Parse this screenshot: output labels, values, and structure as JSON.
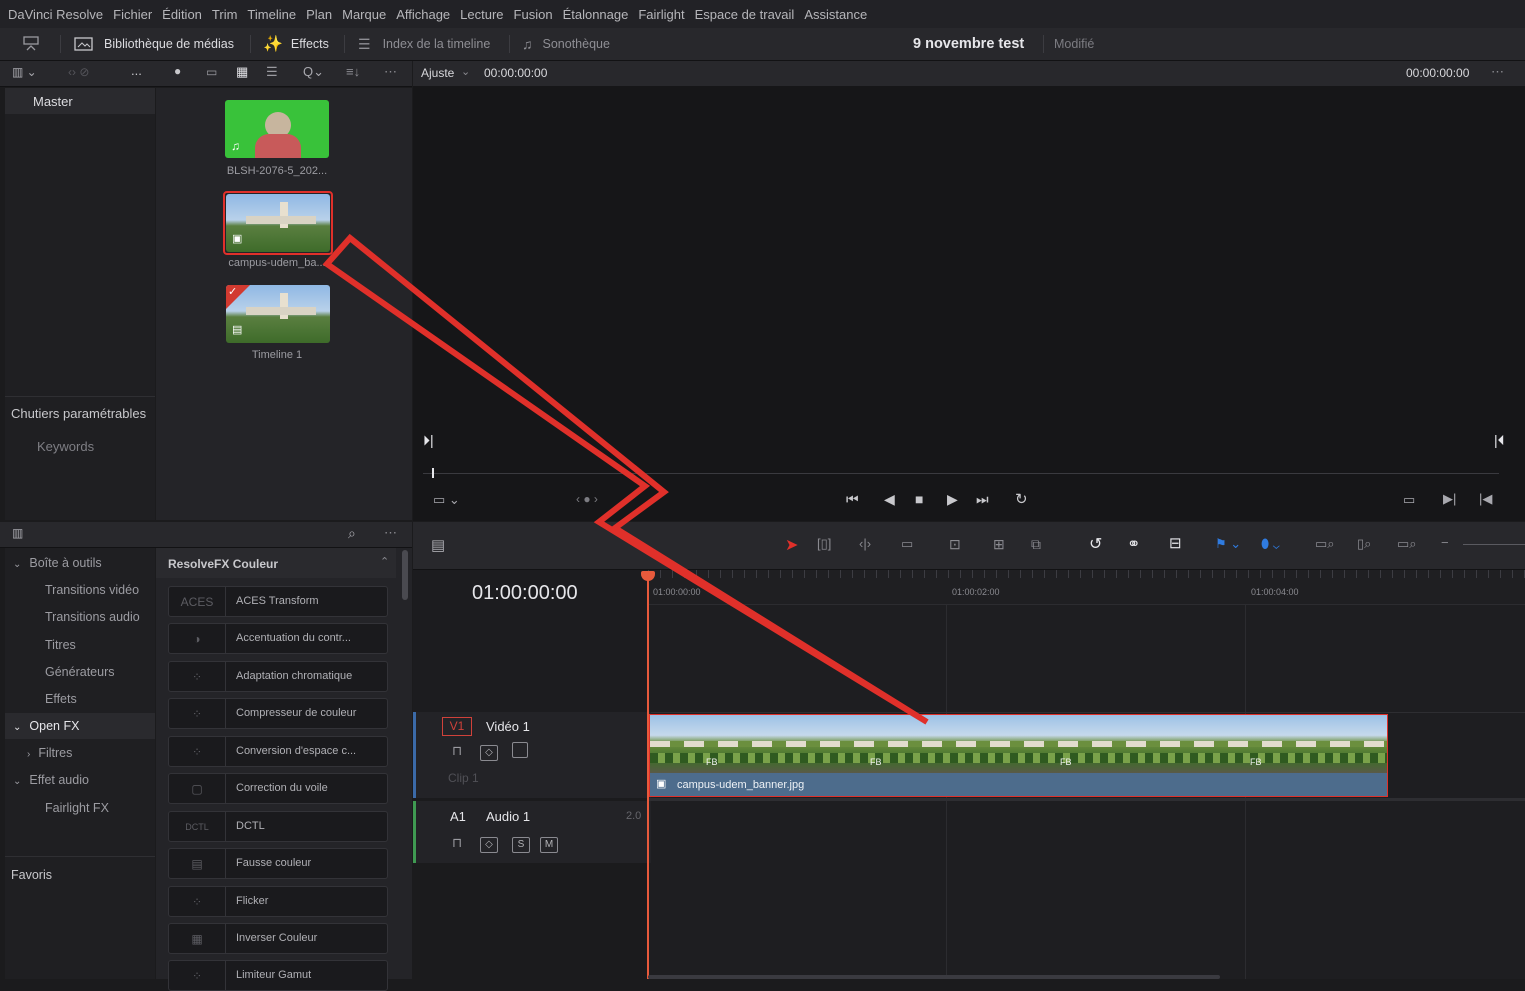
{
  "menu": [
    "DaVinci Resolve",
    "Fichier",
    "Édition",
    "Trim",
    "Timeline",
    "Plan",
    "Marque",
    "Affichage",
    "Lecture",
    "Fusion",
    "Étalonnage",
    "Fairlight",
    "Espace de travail",
    "Assistance"
  ],
  "toolbar": {
    "media_pool": "Bibliothèque de médias",
    "effects": "Effects",
    "timeline_index": "Index de la timeline",
    "sound_library": "Sonothèque",
    "project_title": "9 novembre test",
    "project_status": "Modifié"
  },
  "media_pool": {
    "ellipsis": "...",
    "bins": {
      "master": "Master",
      "smart_bins": "Chutiers paramétrables",
      "keywords": "Keywords"
    },
    "clips": [
      {
        "name": "BLSH-2076-5_202..."
      },
      {
        "name": "campus-udem_ba..."
      },
      {
        "name": "Timeline 1"
      }
    ]
  },
  "viewer": {
    "zoom": "Ajuste",
    "timecode_left": "00:00:00:00",
    "timecode_right": "00:00:00:00"
  },
  "effects": {
    "nav": [
      {
        "label": "Boîte à outils",
        "level": 0,
        "arrow": "v"
      },
      {
        "label": "Transitions vidéo",
        "level": 1
      },
      {
        "label": "Transitions audio",
        "level": 1
      },
      {
        "label": "Titres",
        "level": 1
      },
      {
        "label": "Générateurs",
        "level": 1
      },
      {
        "label": "Effets",
        "level": 1
      },
      {
        "label": "Open FX",
        "level": 0,
        "arrow": "v"
      },
      {
        "label": "Filtres",
        "level": 1,
        "arrow": ">"
      },
      {
        "label": "Effet audio",
        "level": 0,
        "arrow": "v"
      },
      {
        "label": "Fairlight FX",
        "level": 1
      }
    ],
    "favorites": "Favoris",
    "category": "ResolveFX Couleur",
    "items": [
      {
        "name": "ACES Transform",
        "icon": "ACES"
      },
      {
        "name": "Accentuation du contr...",
        "icon": "◑"
      },
      {
        "name": "Adaptation chromatique",
        "icon": "⁘"
      },
      {
        "name": "Compresseur de couleur",
        "icon": "⁘"
      },
      {
        "name": "Conversion d'espace c...",
        "icon": "⁘"
      },
      {
        "name": "Correction du voile",
        "icon": "▢"
      },
      {
        "name": "DCTL",
        "icon": "DCTL"
      },
      {
        "name": "Fausse couleur",
        "icon": "▤"
      },
      {
        "name": "Flicker",
        "icon": "⁘"
      },
      {
        "name": "Inverser Couleur",
        "icon": "▦"
      },
      {
        "name": "Limiteur Gamut",
        "icon": "⁘"
      }
    ]
  },
  "timeline": {
    "timecode": "01:00:00:00",
    "ruler": [
      "01:00:00:00",
      "01:00:02:00",
      "01:00:04:00"
    ],
    "video_track": {
      "id": "V1",
      "name": "Vidéo 1",
      "clip_count": "Clip 1"
    },
    "audio_track": {
      "id": "A1",
      "name": "Audio 1",
      "channels": "2.0",
      "solo": "S",
      "mute": "M"
    },
    "clip_name": "campus-udem_banner.jpg",
    "clip_frame_label": "FB"
  },
  "colors": {
    "accent_red": "#e0302a",
    "clip_blue": "#4d6c8c",
    "playhead": "#e85a3c"
  }
}
